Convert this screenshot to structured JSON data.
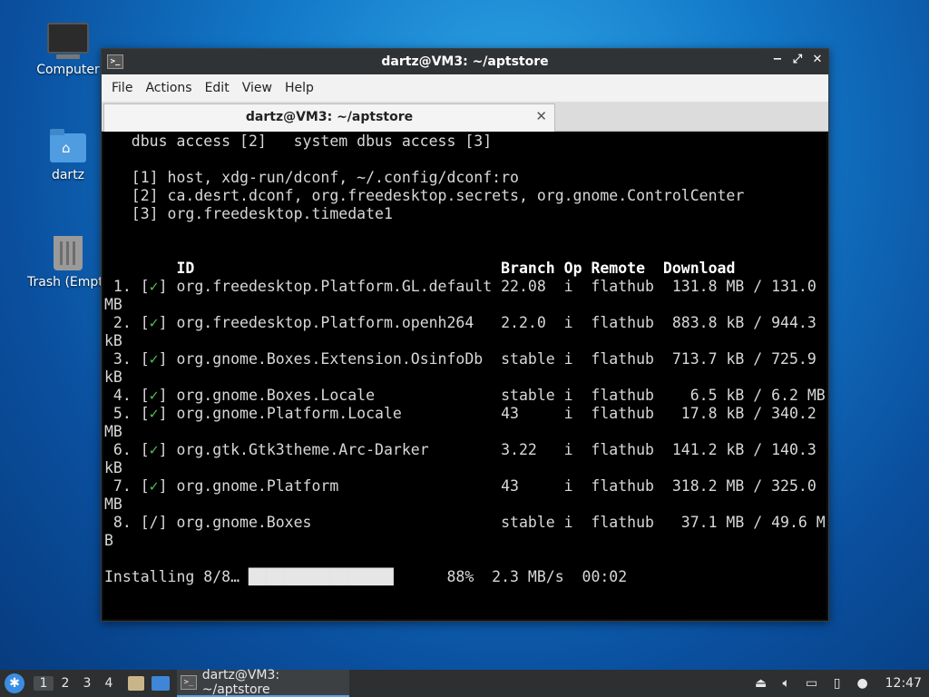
{
  "desktop": {
    "icons": [
      {
        "label": "Computer"
      },
      {
        "label": "dartz"
      },
      {
        "label": "Trash (Empty)"
      }
    ]
  },
  "window": {
    "title": "dartz@VM3: ~/aptstore",
    "controls": {
      "minimize": "−",
      "maximize": "⤢",
      "close": "✕"
    },
    "menu": [
      "File",
      "Actions",
      "Edit",
      "View",
      "Help"
    ],
    "tab": {
      "title": "dartz@VM3: ~/aptstore",
      "close": "✕"
    }
  },
  "terminal": {
    "perm_header": "   dbus access [2]   system dbus access [3]",
    "perm_lines": [
      "   [1] host, xdg-run/dconf, ~/.config/dconf:ro",
      "   [2] ca.desrt.dconf, org.freedesktop.secrets, org.gnome.ControlCenter",
      "   [3] org.freedesktop.timedate1"
    ],
    "table_header": {
      "id": "ID",
      "branch": "Branch",
      "op": "Op",
      "remote": "Remote",
      "download": "Download"
    },
    "rows": [
      {
        "num": "1.",
        "status": "✓",
        "id": "org.freedesktop.Platform.GL.default",
        "branch": "22.08",
        "op": "i",
        "remote": "flathub",
        "download": "131.8 MB / 131.0 MB"
      },
      {
        "num": "2.",
        "status": "✓",
        "id": "org.freedesktop.Platform.openh264",
        "branch": "2.2.0",
        "op": "i",
        "remote": "flathub",
        "download": "883.8 kB / 944.3 kB"
      },
      {
        "num": "3.",
        "status": "✓",
        "id": "org.gnome.Boxes.Extension.OsinfoDb",
        "branch": "stable",
        "op": "i",
        "remote": "flathub",
        "download": "713.7 kB / 725.9 kB"
      },
      {
        "num": "4.",
        "status": "✓",
        "id": "org.gnome.Boxes.Locale",
        "branch": "stable",
        "op": "i",
        "remote": "flathub",
        "download": "  6.5 kB / 6.2 MB"
      },
      {
        "num": "5.",
        "status": "✓",
        "id": "org.gnome.Platform.Locale",
        "branch": "43",
        "op": "i",
        "remote": "flathub",
        "download": " 17.8 kB / 340.2 MB"
      },
      {
        "num": "6.",
        "status": "✓",
        "id": "org.gtk.Gtk3theme.Arc-Darker",
        "branch": "3.22",
        "op": "i",
        "remote": "flathub",
        "download": "141.2 kB / 140.3 kB"
      },
      {
        "num": "7.",
        "status": "✓",
        "id": "org.gnome.Platform",
        "branch": "43",
        "op": "i",
        "remote": "flathub",
        "download": "318.2 MB / 325.0 MB"
      },
      {
        "num": "8.",
        "status": "/",
        "id": "org.gnome.Boxes",
        "branch": "stable",
        "op": "i",
        "remote": "flathub",
        "download": " 37.1 MB / 49.6 MB"
      }
    ],
    "progress": {
      "label": "Installing 8/8…",
      "percent": 88,
      "percent_text": "88%",
      "speed": "2.3 MB/s",
      "eta": "00:02"
    }
  },
  "taskbar": {
    "workspaces": [
      "1",
      "2",
      "3",
      "4"
    ],
    "active_workspace": 0,
    "task_label": "dartz@VM3: ~/aptstore",
    "clock": "12:47"
  }
}
